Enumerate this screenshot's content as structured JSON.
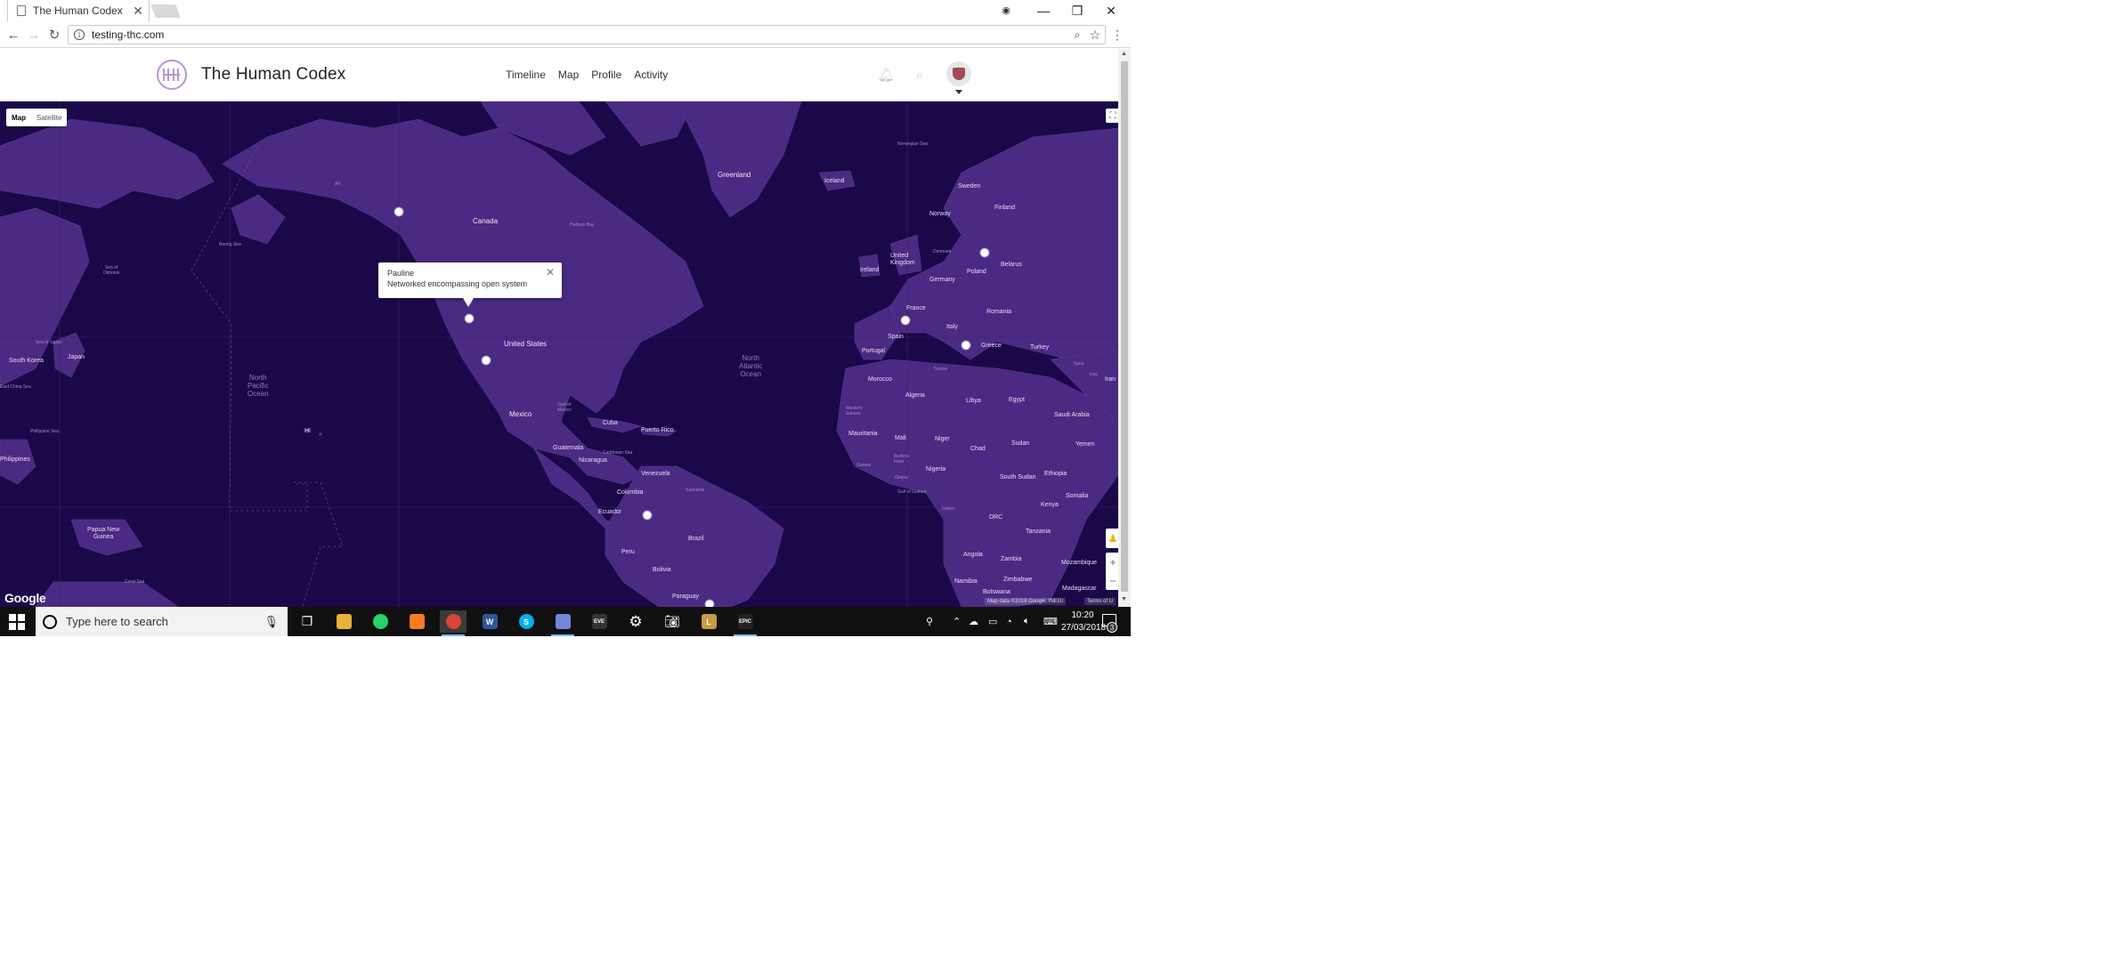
{
  "browser": {
    "tab_title": "The Human Codex",
    "url": "testing-thc.com"
  },
  "site": {
    "title": "The Human Codex",
    "nav": [
      "Timeline",
      "Map",
      "Profile",
      "Activity"
    ]
  },
  "map": {
    "type_buttons": [
      "Map",
      "Satellite"
    ],
    "active_type": "Map",
    "google_logo": "Google",
    "attribution": "Map data ©2018 Google, INEGI",
    "terms": "Terms of U",
    "colors": {
      "water": "#1a0848",
      "land": "#4a2a82",
      "marker": "#ffffff"
    },
    "info_window": {
      "name": "Pauline",
      "description": "Networked encompassing open system"
    },
    "labels": {
      "greenland": "Greenland",
      "iceland": "Iceland",
      "canada": "Canada",
      "hudson_bay": "Hudson Bay",
      "norway": "Norway",
      "sweden": "Sweden",
      "finland": "Finland",
      "united_kingdom": "United\nKingdom",
      "ireland": "Ireland",
      "denmark": "Denmark",
      "belarus": "Belarus",
      "poland": "Poland",
      "germany": "Germany",
      "france": "France",
      "romania": "Romania",
      "spain": "Spain",
      "italy": "Italy",
      "portugal": "Portugal",
      "greece": "Greece",
      "turkey": "Turkey",
      "united_states": "United States",
      "mexico": "Mexico",
      "cuba": "Cuba",
      "puerto_rico": "Puerto Rico",
      "guatemala": "Guatemala",
      "nicaragua": "Nicaragua",
      "venezuela": "Venezuela",
      "colombia": "Colombia",
      "suriname": "Suriname",
      "ecuador": "Ecuador",
      "peru": "Peru",
      "brazil": "Brazil",
      "bolivia": "Bolivia",
      "paraguay": "Paraguay",
      "morocco": "Morocco",
      "algeria": "Algeria",
      "libya": "Libya",
      "egypt": "Egypt",
      "tunisia": "Tunisia",
      "western_sahara": "Western\nSahara",
      "mauritania": "Mauritania",
      "mali": "Mali",
      "niger": "Niger",
      "chad": "Chad",
      "sudan": "Sudan",
      "nigeria": "Nigeria",
      "burkina_faso": "Burkina\nFaso",
      "guinea": "Guinea",
      "ghana": "Ghana",
      "south_sudan": "South Sudan",
      "ethiopia": "Ethiopia",
      "somalia": "Somalia",
      "kenya": "Kenya",
      "drc": "DRC",
      "tanzania": "Tanzania",
      "angola": "Angola",
      "zambia": "Zambia",
      "mozambique": "Mozambique",
      "namibia": "Namibia",
      "zimbabwe": "Zimbabwe",
      "botswana": "Botswana",
      "madagascar": "Madagascar",
      "gabon": "Gabon",
      "saudi_arabia": "Saudi Arabia",
      "yemen": "Yemen",
      "syria": "Syria",
      "iraq": "Iraq",
      "iran": "Iran",
      "south_korea": "South Korea",
      "japan": "Japan",
      "philippines": "Philippines",
      "papua_new_guinea": "Papua New\nGuinea",
      "north_pacific": "North\nPacific\nOcean",
      "north_atlantic": "North\nAtlantic\nOcean",
      "sea_of_okhotsk": "Sea of\nOkhotsk",
      "bering_sea": "Bering Sea",
      "sea_of_japan": "Sea of Japan",
      "east_china_sea": "East China Sea",
      "philippine_sea": "Philippine Sea",
      "coral_sea": "Coral Sea",
      "caribbean_sea": "Caribbean Sea",
      "gulf_of_mexico": "Gulf of\nMexico",
      "gulf_of_guinea": "Gulf of Guinea",
      "norwegian_sea": "Norwegian Sea",
      "hi": "HI",
      "ak": "AK"
    }
  },
  "taskbar": {
    "search_placeholder": "Type here to search",
    "time": "10:20",
    "date": "27/03/2018",
    "notification_count": "3"
  }
}
